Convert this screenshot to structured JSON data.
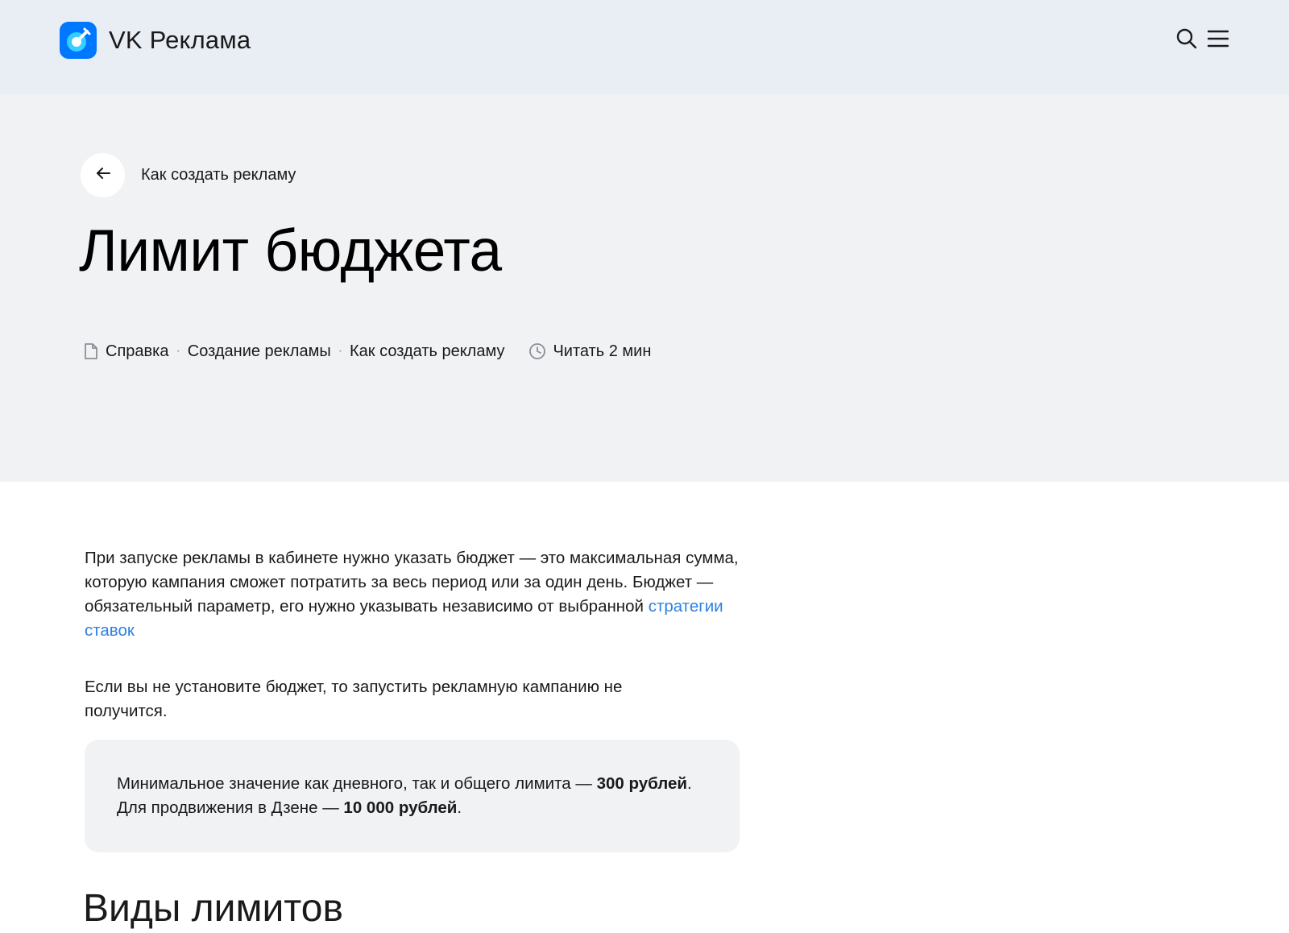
{
  "header": {
    "brand": "VK Реклама"
  },
  "hero": {
    "back_label": "Как создать рекламу",
    "title": "Лимит бюджета",
    "breadcrumbs": [
      "Справка",
      "Создание рекламы",
      "Как создать рекламу"
    ],
    "separator": "·",
    "read_time": "Читать 2 мин"
  },
  "article": {
    "para1_text": "При запуске рекламы в кабинете нужно указать бюджет — это максимальная сумма, которую кампания сможет потратить за весь период или за один день. Бюджет — обязательный параметр, его нужно указывать независимо от выбранной ",
    "para1_link": "стратегии ставок",
    "para2": "Если вы не установите бюджет, то запустить рекламную кампанию не получится.",
    "note": {
      "part1": "Минимальное значение как дневного, так и общего лимита — ",
      "bold1": "300 рублей",
      "part2": ". Для продвижения в Дзене — ",
      "bold2": "10 000 рублей",
      "part3": "."
    },
    "section_heading": "Виды лимитов"
  },
  "colors": {
    "header_bg": "#e9edf4",
    "hero_bg": "#f1f2f4",
    "link": "#2d81e0",
    "logo_blue": "#0077ff"
  },
  "icons": [
    "vk-ads-logo-icon",
    "search-icon",
    "menu-icon",
    "arrow-left-icon",
    "document-icon",
    "clock-icon"
  ]
}
